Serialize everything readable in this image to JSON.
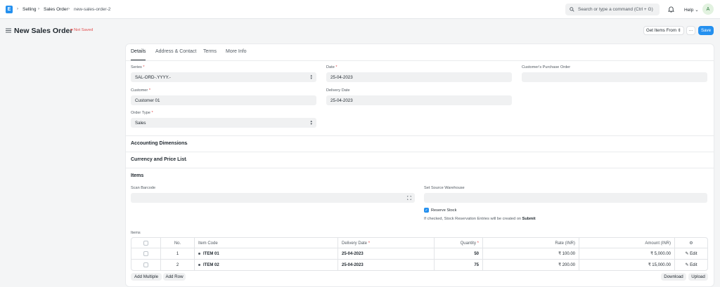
{
  "navbar": {
    "logo": "E",
    "breadcrumbs": [
      "Selling",
      "Sales Order",
      "new-sales-order-2"
    ],
    "search_placeholder": "Search or type a command (Ctrl + G)",
    "help": "Help",
    "avatar_initial": "A"
  },
  "page": {
    "title": "New Sales Order",
    "status": "Not Saved",
    "get_items_from": "Get Items From",
    "more": "···",
    "save": "Save"
  },
  "tabs": [
    "Details",
    "Address & Contact",
    "Terms",
    "More Info"
  ],
  "form": {
    "series_label": "Series",
    "series_value": "SAL-ORD-.YYYY.-",
    "date_label": "Date",
    "date_value": "25-04-2023",
    "customer_po_label": "Customer's Purchase Order",
    "customer_po_value": "",
    "customer_label": "Customer",
    "customer_value": "Customer 01",
    "delivery_date_label": "Delivery Date",
    "delivery_date_value": "25-04-2023",
    "order_type_label": "Order Type",
    "order_type_value": "Sales"
  },
  "sections": {
    "accounting": "Accounting Dimensions",
    "currency": "Currency and Price List",
    "items": "Items"
  },
  "items_section": {
    "scan_barcode_label": "Scan Barcode",
    "set_source_warehouse_label": "Set Source Warehouse",
    "reserve_stock_label": "Reserve Stock",
    "reserve_stock_checked": true,
    "reserve_note_prefix": "If checked, Stock Reservation Entries will be created on",
    "reserve_note_bold": "Submit",
    "table_label": "Items"
  },
  "grid": {
    "columns": [
      "No.",
      "Item Code",
      "Delivery Date",
      "Quantity",
      "Rate (INR)",
      "Amount (INR)"
    ],
    "rows": [
      {
        "no": "1",
        "item_code": "ITEM 01",
        "delivery_date": "25-04-2023",
        "qty": "50",
        "rate": "₹ 100.00",
        "amount": "₹ 5,000.00",
        "edit": "Edit"
      },
      {
        "no": "2",
        "item_code": "ITEM 02",
        "delivery_date": "25-04-2023",
        "qty": "75",
        "rate": "₹ 200.00",
        "amount": "₹ 15,000.00",
        "edit": "Edit"
      }
    ],
    "add_multiple": "Add Multiple",
    "add_row": "Add Row",
    "download": "Download",
    "upload": "Upload"
  },
  "colors": {
    "primary": "#2490ef",
    "danger": "#e24c4c"
  }
}
